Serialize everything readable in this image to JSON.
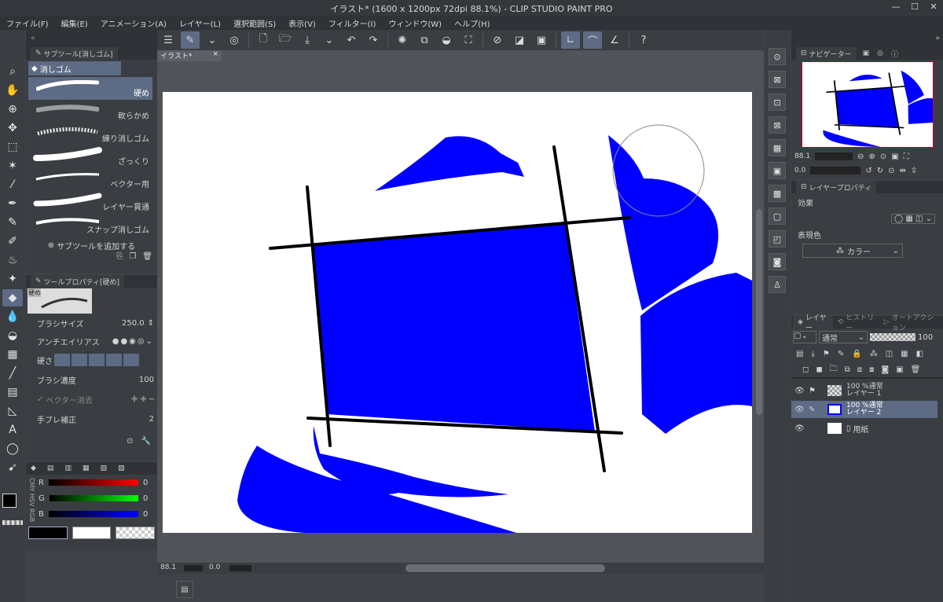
{
  "titlebar": {
    "title": "イラスト* (1600 x 1200px 72dpi 88.1%)  - CLIP STUDIO PAINT PRO",
    "minimize": "—",
    "maximize": "☐",
    "close": "✕"
  },
  "menu": [
    "ファイル(F)",
    "編集(E)",
    "アニメーション(A)",
    "レイヤー(L)",
    "選択範囲(S)",
    "表示(V)",
    "フィルター(I)",
    "ウィンドウ(W)",
    "ヘルプ(H)"
  ],
  "subtool": {
    "header": "サブツール[消しゴム]",
    "group": "消しゴム",
    "items": [
      "硬め",
      "軟らかめ",
      "練り消しゴム",
      "ざっくり",
      "ベクター用",
      "レイヤー貫通",
      "スナップ消しゴム"
    ],
    "add_label": "サブツールを追加する"
  },
  "toolprop": {
    "header": "ツールプロパティ[硬め]",
    "preview_label": "硬め",
    "brush_size_label": "ブラシサイズ",
    "brush_size": "250.0",
    "antialias_label": "アンチエイリアス",
    "hardness_label": "硬さ",
    "density_label": "ブラシ濃度",
    "density": "100",
    "vector_erase_label": "ベクター消去",
    "stabilization_label": "手ブレ補正",
    "stabilization": "2"
  },
  "color": {
    "side_label": "CMY HSV RGB",
    "r_label": "R",
    "r": "0",
    "g_label": "G",
    "g": "0",
    "b_label": "B",
    "b": "0",
    "main": "#000000",
    "sub": "#ffffff"
  },
  "document": {
    "tab": "イラスト*",
    "close": "×"
  },
  "status": {
    "zoom": "88.1",
    "angle": "0.0"
  },
  "navigator": {
    "header": "ナビゲーター",
    "zoom": "88.1",
    "angle": "0.0"
  },
  "layerprop": {
    "header": "レイヤープロパティ",
    "effect_label": "効果",
    "expression_label": "表現色",
    "expression_value": "カラー"
  },
  "layers": {
    "tabs": [
      "レイヤー",
      "ヒストリー",
      "オートアクション"
    ],
    "blend": "通常",
    "opacity": "100",
    "items": [
      {
        "mode": "100 %通常",
        "name": "レイヤー 1"
      },
      {
        "mode": "100 %通常",
        "name": "レイヤー 2"
      },
      {
        "mode": "",
        "name": "用紙"
      }
    ]
  },
  "colors": {
    "blue": "#0000ff",
    "selected": "#5d6b84"
  }
}
